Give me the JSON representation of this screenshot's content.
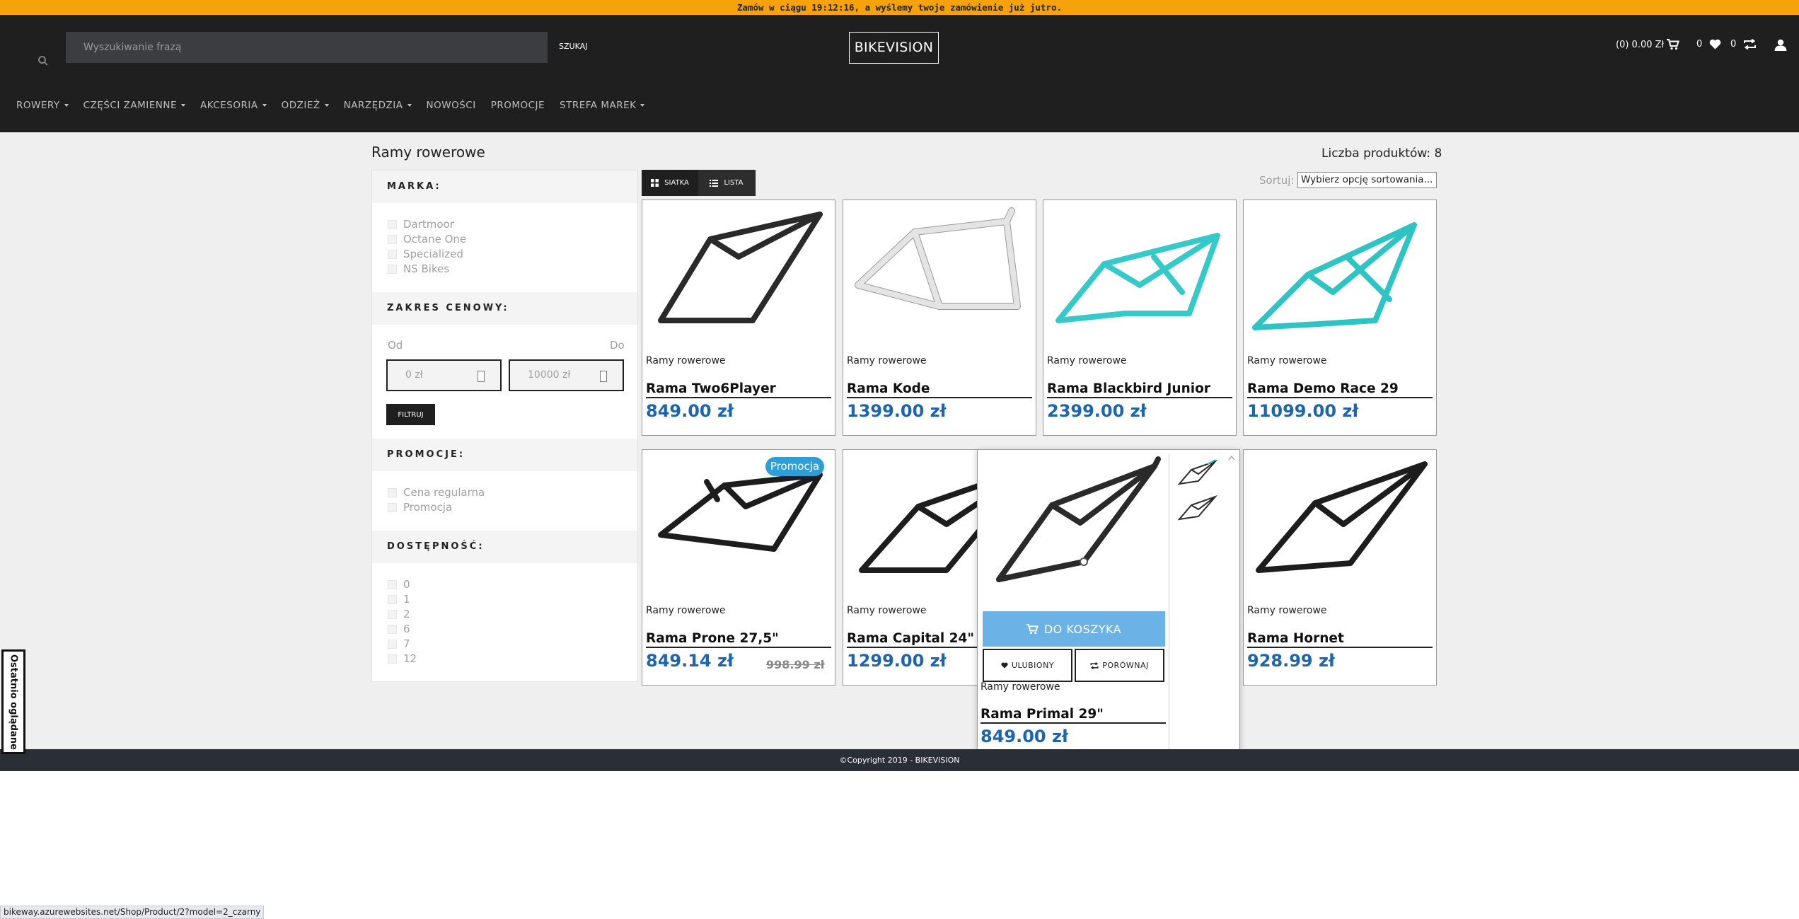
{
  "topbar": {
    "message": "Zamów w ciągu 19:12:16, a wyślemy twoje zamówienie już jutro."
  },
  "header": {
    "search_placeholder": "Wyszukiwanie frazą",
    "search_button": "SZUKAJ",
    "logo": "BIKEVISION",
    "cart_label": "(0) 0.00 Zł",
    "wishlist_count": "0",
    "compare_count": "0"
  },
  "nav": {
    "items": [
      {
        "label": "ROWERY",
        "dropdown": true
      },
      {
        "label": "CZĘŚCI ZAMIENNE",
        "dropdown": true
      },
      {
        "label": "AKCESORIA",
        "dropdown": true
      },
      {
        "label": "ODZIEŻ",
        "dropdown": true
      },
      {
        "label": "NARZĘDZIA",
        "dropdown": true
      },
      {
        "label": "NOWOŚCI",
        "dropdown": false
      },
      {
        "label": "PROMOCJE",
        "dropdown": false
      },
      {
        "label": "STREFA MAREK",
        "dropdown": true
      }
    ]
  },
  "page": {
    "title": "Ramy rowerowe",
    "product_count": "Liczba produktów: 8"
  },
  "filters": {
    "brand": {
      "title": "MARKA:",
      "options": [
        "Dartmoor",
        "Octane One",
        "Specialized",
        "NS Bikes"
      ]
    },
    "price": {
      "title": "ZAKRES CENOWY:",
      "from_label": "Od",
      "to_label": "Do",
      "from_value": "0 zł",
      "to_value": "10000 zł",
      "button": "FILTRUJ"
    },
    "promo": {
      "title": "PROMOCJE:",
      "options": [
        "Cena regularna",
        "Promocja"
      ]
    },
    "availability": {
      "title": "DOSTĘPNOŚĆ:",
      "options": [
        "0",
        "1",
        "2",
        "6",
        "7",
        "12"
      ]
    }
  },
  "toolbar": {
    "grid_label": "SIATKA",
    "list_label": "LISTA",
    "sort_label": "Sortuj:",
    "sort_value": "Wybierz opcję sortowania..."
  },
  "products": [
    {
      "category": "Ramy rowerowe",
      "name": "Rama Two6Player",
      "price": "849.00 zł",
      "color": "#2a2a2a"
    },
    {
      "category": "Ramy rowerowe",
      "name": "Rama Kode",
      "price": "1399.00 zł",
      "color": "#e4e4e4"
    },
    {
      "category": "Ramy rowerowe",
      "name": "Rama Blackbird Junior",
      "price": "2399.00 zł",
      "color": "#35c9c9"
    },
    {
      "category": "Ramy rowerowe",
      "name": "Rama Demo Race 29",
      "price": "11099.00 zł",
      "color": "#2ec4c4"
    },
    {
      "category": "Ramy rowerowe",
      "name": "Rama Prone 27,5\"",
      "price": "849.14 zł",
      "old_price": "998.99 zł",
      "badge": "Promocja",
      "color": "#1d1d1d"
    },
    {
      "category": "Ramy rowerowe",
      "name": "Rama Capital 24\"",
      "price": "1299.00 zł",
      "color": "#1d1d1d"
    },
    {
      "category": "Ramy rowerowe",
      "name": "Rama Primal 29\"",
      "price": "849.00 zł",
      "color": "#2a2a2a"
    },
    {
      "category": "Ramy rowerowe",
      "name": "Rama Hornet",
      "price": "928.99 zł",
      "color": "#1d1d1d"
    }
  ],
  "hover_card": {
    "add_to_cart": "DO KOSZYKA",
    "wishlist": "ULUBIONY",
    "compare": "PORÓWNAJ"
  },
  "footer": {
    "copyright": "©Copyright 2019 - BIKEVISION"
  },
  "recently_viewed": "Ostatnio oglądane",
  "status_url": "bikeway.azurewebsites.net/Shop/Product/2?model=2_czarny",
  "colors": {
    "accent": "#f5a20b",
    "price": "#1d65b0",
    "header_bg": "#1f1f1f",
    "promo_badge": "#2d9fd6",
    "cart_button": "#6bb3e6"
  }
}
